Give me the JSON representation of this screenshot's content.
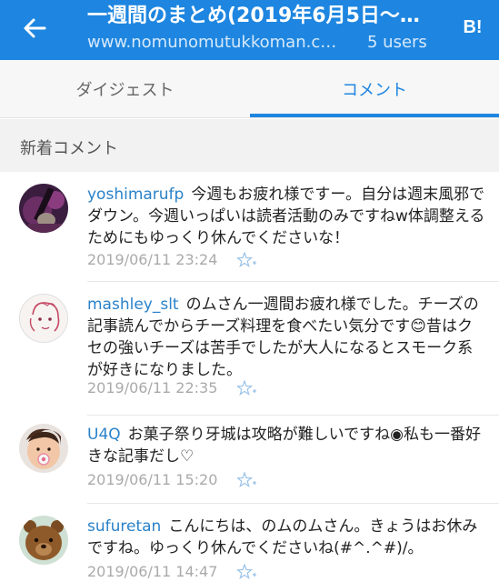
{
  "appbar": {
    "back_label": "back",
    "title": "一週間のまとめ(2019年6月5日〜…",
    "url": "www.nomunomutukkoman.c…",
    "users": "5 users",
    "hatebu": "B!",
    "bg_color": "#1e86e0"
  },
  "tabs": [
    {
      "label": "ダイジェスト",
      "active": false
    },
    {
      "label": "コメント",
      "active": true
    }
  ],
  "section": {
    "label": "新着コメント"
  },
  "comments": [
    {
      "user": "yoshimarufp",
      "text": "今週もお疲れ様ですー。自分は週末風邪でダウン。今週いっぱいは読者活動のみですねw体調整えるためにもゆっくり休んでくださいな！",
      "date": "2019/06/11 23:24",
      "avatar": "guitar-avatar"
    },
    {
      "user": "mashley_slt",
      "text": "のムさん一週間お疲れ様でした。チーズの記事読んでからチーズ料理を食べたい気分です😊昔はクセの強いチーズは苦手でしたが大人になるとスモーク系が好きになりました。",
      "date": "2019/06/11 22:35",
      "avatar": "sketch-face-avatar"
    },
    {
      "user": "U4Q",
      "text": "お菓子祭り牙城は攻略が難しいですね◉私も一番好きな記事だし♡",
      "date": "2019/06/11 15:20",
      "avatar": "baby-avatar"
    },
    {
      "user": "sufuretan",
      "text": "こんにちは、のムのムさん。きょうはお休みですね。ゆっくり休んでくださいね(#^.^#)/。",
      "date": "2019/06/11 14:47",
      "avatar": "teddy-bear-avatar"
    }
  ]
}
